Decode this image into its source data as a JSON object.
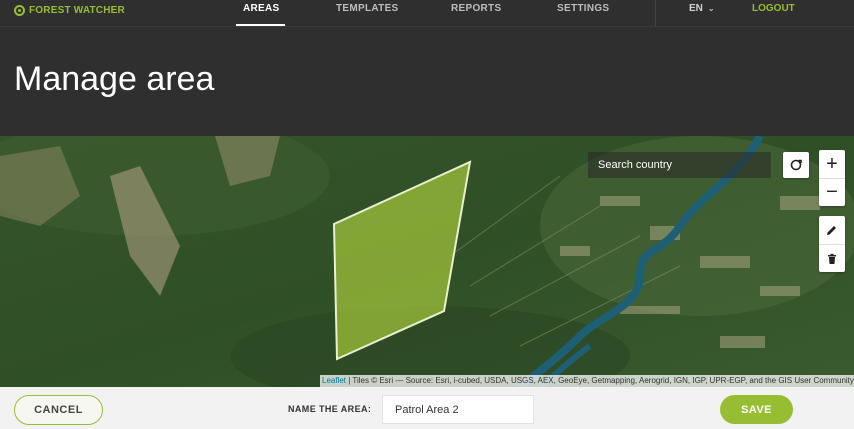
{
  "brand": {
    "name": "FOREST WATCHER",
    "icon": "target-icon",
    "color": "#97be32"
  },
  "nav": {
    "tabs": [
      {
        "label": "AREAS",
        "active": true
      },
      {
        "label": "TEMPLATES",
        "active": false
      },
      {
        "label": "REPORTS",
        "active": false
      },
      {
        "label": "SETTINGS",
        "active": false
      }
    ],
    "language": "EN",
    "logout": "LOGOUT"
  },
  "page": {
    "title": "Manage area"
  },
  "map": {
    "search_placeholder": "Search country",
    "controls": {
      "locate": "locate-icon",
      "zoom_in": "+",
      "zoom_out": "−",
      "draw": "pencil-icon",
      "delete": "trash-icon"
    },
    "attribution": {
      "leaflet": "Leaflet",
      "text": " | Tiles © Esri — Source: Esri, i-cubed, USDA, USGS, AEX, GeoEye, Getmapping, Aerogrid, IGN, IGP, UPR-EGP, and the GIS User Community"
    },
    "polygon_fill": "#a7c93b"
  },
  "footer": {
    "cancel_label": "CANCEL",
    "name_label": "NAME THE AREA:",
    "name_value": "Patrol Area 2",
    "save_label": "SAVE"
  }
}
